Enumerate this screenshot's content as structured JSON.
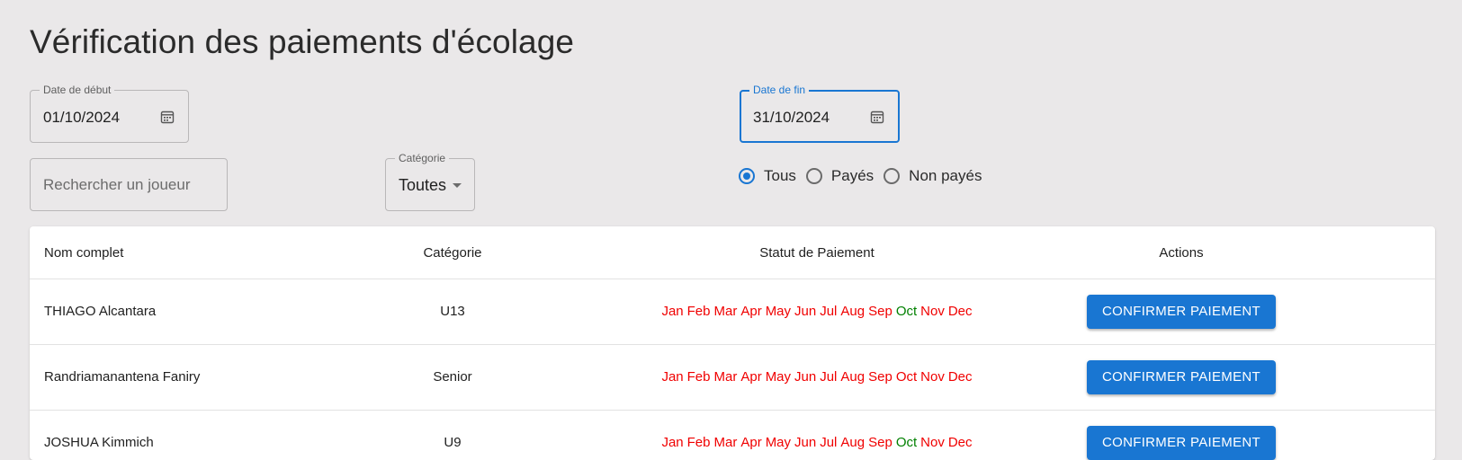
{
  "page": {
    "title": "Vérification des paiements d'écolage"
  },
  "filters": {
    "date_start": {
      "label": "Date de début",
      "value": "01/10/2024",
      "icon": "calendar-icon"
    },
    "date_end": {
      "label": "Date de fin",
      "value": "31/10/2024",
      "icon": "calendar-icon"
    },
    "search": {
      "placeholder": "Rechercher un joueur",
      "value": ""
    },
    "category": {
      "label": "Catégorie",
      "value": "Toutes"
    },
    "status_radios": [
      {
        "label": "Tous",
        "checked": true
      },
      {
        "label": "Payés",
        "checked": false
      },
      {
        "label": "Non payés",
        "checked": false
      }
    ]
  },
  "colors": {
    "accent": "#1976d2",
    "unpaid": "#f00000",
    "paid": "#008000"
  },
  "table": {
    "headers": {
      "name": "Nom complet",
      "category": "Catégorie",
      "status": "Statut de Paiement",
      "actions": "Actions"
    },
    "rows": [
      {
        "name": "THIAGO Alcantara",
        "category": "U13",
        "action": "CONFIRMER PAIEMENT",
        "months": [
          {
            "m": "Jan",
            "paid": false
          },
          {
            "m": "Feb",
            "paid": false
          },
          {
            "m": "Mar",
            "paid": false
          },
          {
            "m": "Apr",
            "paid": false
          },
          {
            "m": "May",
            "paid": false
          },
          {
            "m": "Jun",
            "paid": false
          },
          {
            "m": "Jul",
            "paid": false
          },
          {
            "m": "Aug",
            "paid": false
          },
          {
            "m": "Sep",
            "paid": false
          },
          {
            "m": "Oct",
            "paid": true
          },
          {
            "m": "Nov",
            "paid": false
          },
          {
            "m": "Dec",
            "paid": false
          }
        ]
      },
      {
        "name": "Randriamanantena Faniry",
        "category": "Senior",
        "action": "CONFIRMER PAIEMENT",
        "months": [
          {
            "m": "Jan",
            "paid": false
          },
          {
            "m": "Feb",
            "paid": false
          },
          {
            "m": "Mar",
            "paid": false
          },
          {
            "m": "Apr",
            "paid": false
          },
          {
            "m": "May",
            "paid": false
          },
          {
            "m": "Jun",
            "paid": false
          },
          {
            "m": "Jul",
            "paid": false
          },
          {
            "m": "Aug",
            "paid": false
          },
          {
            "m": "Sep",
            "paid": false
          },
          {
            "m": "Oct",
            "paid": false
          },
          {
            "m": "Nov",
            "paid": false
          },
          {
            "m": "Dec",
            "paid": false
          }
        ]
      },
      {
        "name": "JOSHUA Kimmich",
        "category": "U9",
        "action": "CONFIRMER PAIEMENT",
        "months": [
          {
            "m": "Jan",
            "paid": false
          },
          {
            "m": "Feb",
            "paid": false
          },
          {
            "m": "Mar",
            "paid": false
          },
          {
            "m": "Apr",
            "paid": false
          },
          {
            "m": "May",
            "paid": false
          },
          {
            "m": "Jun",
            "paid": false
          },
          {
            "m": "Jul",
            "paid": false
          },
          {
            "m": "Aug",
            "paid": false
          },
          {
            "m": "Sep",
            "paid": false
          },
          {
            "m": "Oct",
            "paid": true
          },
          {
            "m": "Nov",
            "paid": false
          },
          {
            "m": "Dec",
            "paid": false
          }
        ]
      }
    ]
  }
}
